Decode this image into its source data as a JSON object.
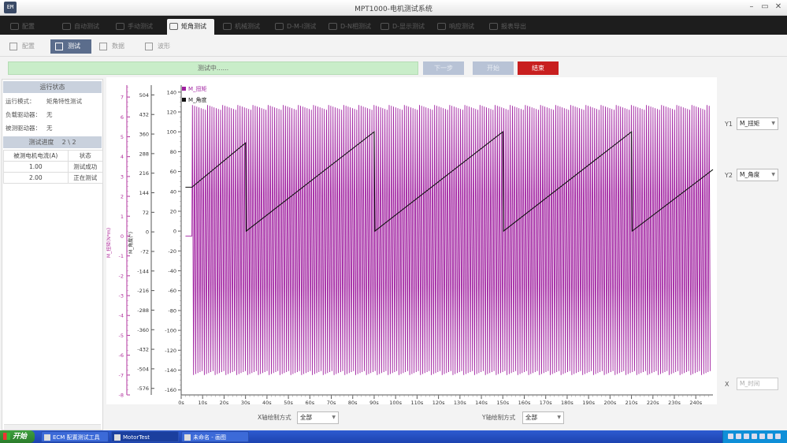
{
  "window": {
    "icon_text": "EM",
    "title": "MPT1000-电机测试系统",
    "controls": [
      "–",
      "▭",
      "✕"
    ]
  },
  "tabs": [
    {
      "label": "配置"
    },
    {
      "label": "自动测试"
    },
    {
      "label": "手动测试"
    },
    {
      "label": "矩角测试",
      "active": true
    },
    {
      "label": "机械测试"
    },
    {
      "label": "D-M-I测试"
    },
    {
      "label": "D-N相测试"
    },
    {
      "label": "D-显示测试"
    },
    {
      "label": "响应测试"
    },
    {
      "label": "报表导出"
    }
  ],
  "subtabs": [
    {
      "label": "配置"
    },
    {
      "label": "测试",
      "active": true
    },
    {
      "label": "数据"
    },
    {
      "label": "波形"
    }
  ],
  "toolbar": {
    "status_text": "测试中......",
    "next_label": "下一步",
    "start_label": "开始",
    "end_label": "结束"
  },
  "left_panel": {
    "run_state_title": "运行状态",
    "run_mode_key": "运行模式：",
    "run_mode_value": "矩角特性测试",
    "load_driver_key": "负载驱动器：",
    "load_driver_value": "无",
    "test_driver_key": "被测驱动器：",
    "test_driver_value": "无",
    "progress_title": "测试进度",
    "progress_value": "2 \\ 2",
    "table_headers": [
      "被测电机电流(A)",
      "状态"
    ],
    "table_rows": [
      [
        "1.00",
        "测试成功"
      ],
      [
        "2.00",
        "正在测试"
      ]
    ]
  },
  "chart_data": {
    "type": "line",
    "series": [
      {
        "name": "M_扭矩",
        "color": "#a020a0",
        "axis": "torque"
      },
      {
        "name": "M_角度",
        "color": "#111111",
        "axis": "angle"
      }
    ],
    "x": {
      "label": "",
      "unit": "s",
      "range": [
        0,
        248
      ],
      "ticks": [
        "0s",
        "10s",
        "20s",
        "30s",
        "40s",
        "50s",
        "60s",
        "70s",
        "80s",
        "90s",
        "100s",
        "110s",
        "120s",
        "130s",
        "140s",
        "150s",
        "160s",
        "170s",
        "180s",
        "190s",
        "200s",
        "210s",
        "220s",
        "230s",
        "240s"
      ]
    },
    "y_torque": {
      "label": "M_扭矩(N*m)",
      "range": [
        -8,
        7.6
      ],
      "ticks": [
        "7",
        "6",
        "5",
        "4",
        "3",
        "2",
        "1",
        "0",
        "-1",
        "-2",
        "-3",
        "-4",
        "-5",
        "-6",
        "-7",
        "-8"
      ]
    },
    "y_angle_deg": {
      "label": "M_角度(°)",
      "range": [
        -600,
        540
      ],
      "ticks": [
        "504",
        "432",
        "360",
        "288",
        "216",
        "144",
        "72",
        "0",
        "-72",
        "-144",
        "-216",
        "-288",
        "-360",
        "-432",
        "-504",
        "-576"
      ]
    },
    "y_inner": {
      "label": "",
      "range": [
        -165,
        147
      ],
      "ticks": [
        "140",
        "120",
        "100",
        "80",
        "60",
        "40",
        "20",
        "0",
        "-20",
        "-40",
        "-60",
        "-80",
        "-100",
        "-120",
        "-140",
        "-160"
      ]
    },
    "torque_oscillation": {
      "start_s": 5,
      "end_s": 247,
      "high_Nm": 6.6,
      "low_Nm": -7.0,
      "cycles": 240,
      "pre_value_Nm": 0
    },
    "angle_segments": [
      {
        "x": [
          2,
          5
        ],
        "y": [
          442,
          442
        ]
      },
      {
        "x": [
          5,
          30
        ],
        "y": [
          442,
          888
        ]
      },
      {
        "x": [
          30,
          30.3
        ],
        "y": [
          888,
          0
        ]
      },
      {
        "x": [
          30.3,
          90
        ],
        "y": [
          0,
          1000
        ]
      },
      {
        "x": [
          90,
          90.3
        ],
        "y": [
          1000,
          0
        ]
      },
      {
        "x": [
          90.3,
          150
        ],
        "y": [
          0,
          1000
        ]
      },
      {
        "x": [
          150,
          150.3
        ],
        "y": [
          1000,
          0
        ]
      },
      {
        "x": [
          150.3,
          210
        ],
        "y": [
          0,
          1000
        ]
      },
      {
        "x": [
          210,
          210.3
        ],
        "y": [
          1000,
          0
        ]
      },
      {
        "x": [
          210.3,
          248
        ],
        "y": [
          0,
          620
        ]
      }
    ]
  },
  "right_panel": {
    "y1_label": "Y1",
    "y1_value": "M_扭矩",
    "y2_label": "Y2",
    "y2_value": "M_角度",
    "x_label": "X",
    "x_value": "M_时间"
  },
  "bottom_controls": {
    "x_mode_label": "X轴绘制方式",
    "x_mode_value": "全部",
    "y_mode_label": "Y轴绘制方式",
    "y_mode_value": "全部"
  },
  "taskbar": {
    "start_label": "开始",
    "tasks": [
      {
        "label": "ECM 配置测试工具"
      },
      {
        "label": "MotorTest",
        "active": true
      },
      {
        "label": "未命名 - 画图"
      }
    ]
  }
}
